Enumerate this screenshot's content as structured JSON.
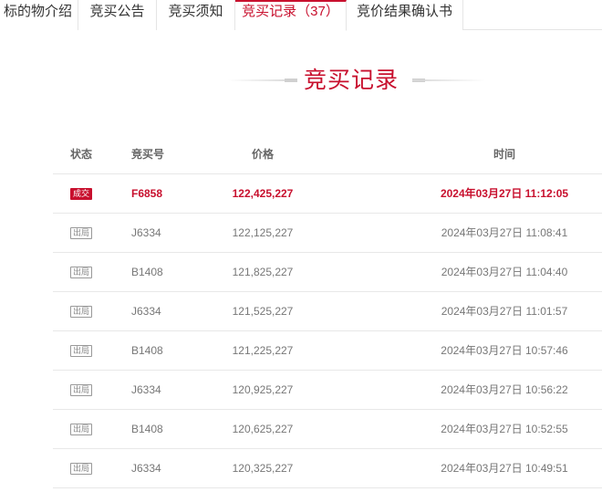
{
  "tabs": [
    {
      "label": "标的物介绍",
      "active": false
    },
    {
      "label": "竞买公告",
      "active": false
    },
    {
      "label": "竞买须知",
      "active": false
    },
    {
      "label": "竞买记录（37）",
      "active": true
    },
    {
      "label": "竞价结果确认书",
      "active": false
    }
  ],
  "section": {
    "title": "竞买记录"
  },
  "table": {
    "headers": {
      "status": "状态",
      "bid_no": "竞买号",
      "price": "价格",
      "time": "时间"
    },
    "rows": [
      {
        "status": "成交",
        "bid_no": "F6858",
        "price": "122,425,227",
        "time": "2024年03月27日 11:12:05",
        "deal": true
      },
      {
        "status": "出局",
        "bid_no": "J6334",
        "price": "122,125,227",
        "time": "2024年03月27日 11:08:41",
        "deal": false
      },
      {
        "status": "出局",
        "bid_no": "B1408",
        "price": "121,825,227",
        "time": "2024年03月27日 11:04:40",
        "deal": false
      },
      {
        "status": "出局",
        "bid_no": "J6334",
        "price": "121,525,227",
        "time": "2024年03月27日 11:01:57",
        "deal": false
      },
      {
        "status": "出局",
        "bid_no": "B1408",
        "price": "121,225,227",
        "time": "2024年03月27日 10:57:46",
        "deal": false
      },
      {
        "status": "出局",
        "bid_no": "J6334",
        "price": "120,925,227",
        "time": "2024年03月27日 10:56:22",
        "deal": false
      },
      {
        "status": "出局",
        "bid_no": "B1408",
        "price": "120,625,227",
        "time": "2024年03月27日 10:52:55",
        "deal": false
      },
      {
        "status": "出局",
        "bid_no": "J6334",
        "price": "120,325,227",
        "time": "2024年03月27日 10:49:51",
        "deal": false
      }
    ]
  },
  "colors": {
    "accent": "#c8102e"
  }
}
